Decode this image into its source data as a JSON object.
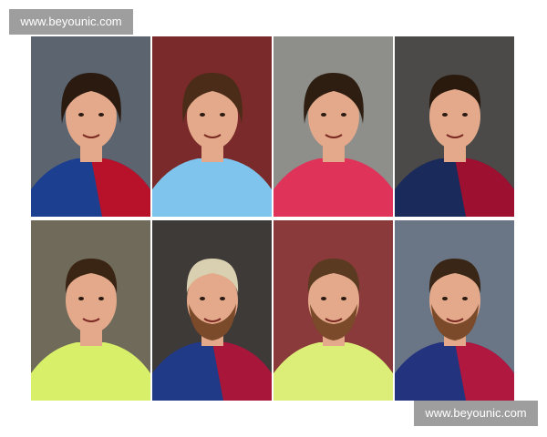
{
  "watermarks": {
    "top_left": "www.beyounic.com",
    "bottom_right": "www.beyounic.com"
  },
  "photos": [
    {
      "row": 1,
      "col": 1,
      "description": "young man with long wet hair smiling, red and blue striped jersey",
      "bg": "#5c6470",
      "shirt": "#1c3f8f",
      "shirt2": "#b8122a",
      "hair": "#2a1a10"
    },
    {
      "row": 1,
      "col": 2,
      "description": "young man with long brown hair, light blue jersey",
      "bg": "#7a2a2a",
      "shirt": "#7fc4ec",
      "hair": "#4a2c18"
    },
    {
      "row": 1,
      "col": 3,
      "description": "man with shoulder-length hair smiling, pink training jacket with crest",
      "bg": "#8e8e8a",
      "shirt": "#e0335a",
      "hair": "#2e1e12"
    },
    {
      "row": 1,
      "col": 4,
      "description": "man with short dark hair, dark blue and red jersey",
      "bg": "#4c4a48",
      "shirt": "#1a2a5a",
      "shirt2": "#9e1030",
      "hair": "#2a1a0e"
    },
    {
      "row": 2,
      "col": 1,
      "description": "smiling man with short hair, yellow-green jersey",
      "bg": "#6f6a5a",
      "shirt": "#d8ef6a",
      "hair": "#3a2414"
    },
    {
      "row": 2,
      "col": 2,
      "description": "man with bleached blond hair and beard, blue and red jersey",
      "bg": "#3e3a38",
      "shirt": "#203a88",
      "shirt2": "#a8163a",
      "hair": "#d8d0b0"
    },
    {
      "row": 2,
      "col": 3,
      "description": "bearded man, yellow-green jersey",
      "bg": "#8a3a3a",
      "shirt": "#dcee78",
      "hair": "#5a3a20"
    },
    {
      "row": 2,
      "col": 4,
      "description": "bearded man, blue and red jersey",
      "bg": "#6a7686",
      "shirt": "#23337e",
      "shirt2": "#b01840",
      "hair": "#3a2616"
    }
  ],
  "colors": {
    "watermark_bg": "#9e9e9e",
    "watermark_text": "#ffffff",
    "skin": "#e3a98a",
    "beard": "#7a4a2a"
  }
}
